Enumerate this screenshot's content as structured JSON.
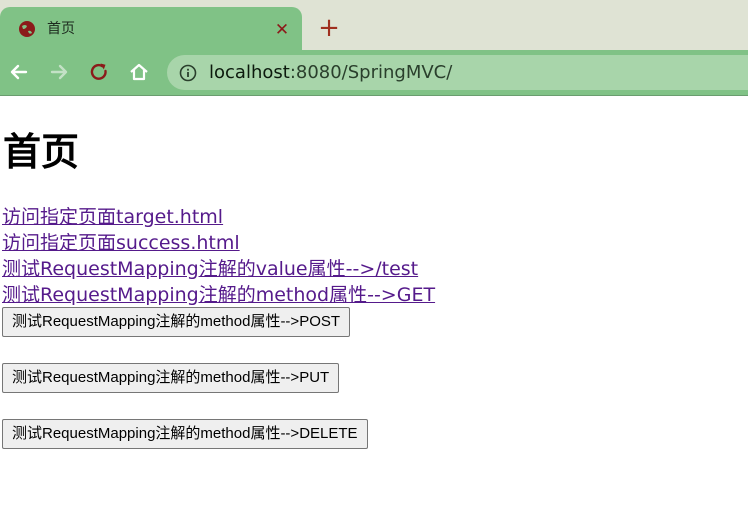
{
  "browser": {
    "tab_title": "首页",
    "url_host": "localhost",
    "url_rest": ":8080/SpringMVC/",
    "colors": {
      "chrome": "#80c286",
      "tabstrip": "#dfe3d4",
      "omnibox": "#a8d5aa"
    },
    "icons": [
      "globe-icon",
      "close-icon",
      "plus-icon",
      "back-arrow-icon",
      "forward-arrow-icon",
      "reload-icon",
      "home-icon",
      "info-icon"
    ]
  },
  "page": {
    "heading": "首页",
    "links": [
      "访问指定页面target.html",
      "访问指定页面success.html",
      "测试RequestMapping注解的value属性-->/test",
      "测试RequestMapping注解的method属性-->GET"
    ],
    "buttons": [
      "测试RequestMapping注解的method属性-->POST",
      "测试RequestMapping注解的method属性-->PUT",
      "测试RequestMapping注解的method属性-->DELETE"
    ],
    "link_color": "#551a8b"
  }
}
